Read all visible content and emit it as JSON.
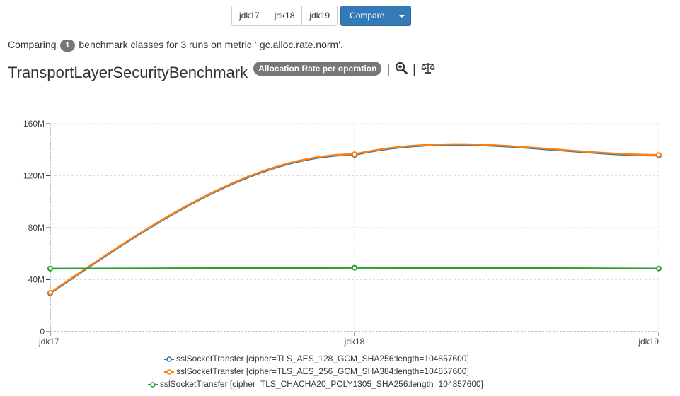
{
  "toolbar": {
    "runs": [
      "jdk17",
      "jdk18",
      "jdk19"
    ],
    "compare_label": "Compare"
  },
  "summary": {
    "prefix": "Comparing",
    "count": "1",
    "suffix": "benchmark classes for 3 runs on metric '·gc.alloc.rate.norm'."
  },
  "header": {
    "title": "TransportLayerSecurityBenchmark",
    "metric_badge": "Allocation Rate per operation",
    "separator": "|"
  },
  "icons": {
    "zoom": "zoom-in-icon",
    "compare": "balance-scale-icon"
  },
  "colors": {
    "series": [
      "#1f77b4",
      "#ff7f0e",
      "#2ca02c"
    ],
    "compare_button": "#337ab7",
    "badge": "#777777"
  },
  "chart_data": {
    "type": "line",
    "categories": [
      "jdk17",
      "jdk18",
      "jdk19"
    ],
    "ylim": [
      0,
      160000000
    ],
    "yticks": [
      0,
      40000000,
      80000000,
      120000000,
      160000000
    ],
    "ytick_labels": [
      "0",
      "40M",
      "80M",
      "120M",
      "160M"
    ],
    "grid": true,
    "legend_position": "bottom",
    "series": [
      {
        "name": "sslSocketTransfer [cipher=TLS_AES_128_GCM_SHA256:length=104857600]",
        "values": [
          29500000,
          136000000,
          135500000
        ]
      },
      {
        "name": "sslSocketTransfer [cipher=TLS_AES_256_GCM_SHA384:length=104857600]",
        "values": [
          30000000,
          136500000,
          136000000
        ]
      },
      {
        "name": "sslSocketTransfer [cipher=TLS_CHACHA20_POLY1305_SHA256:length=104857600]",
        "values": [
          48500000,
          49200000,
          48600000
        ]
      }
    ]
  }
}
